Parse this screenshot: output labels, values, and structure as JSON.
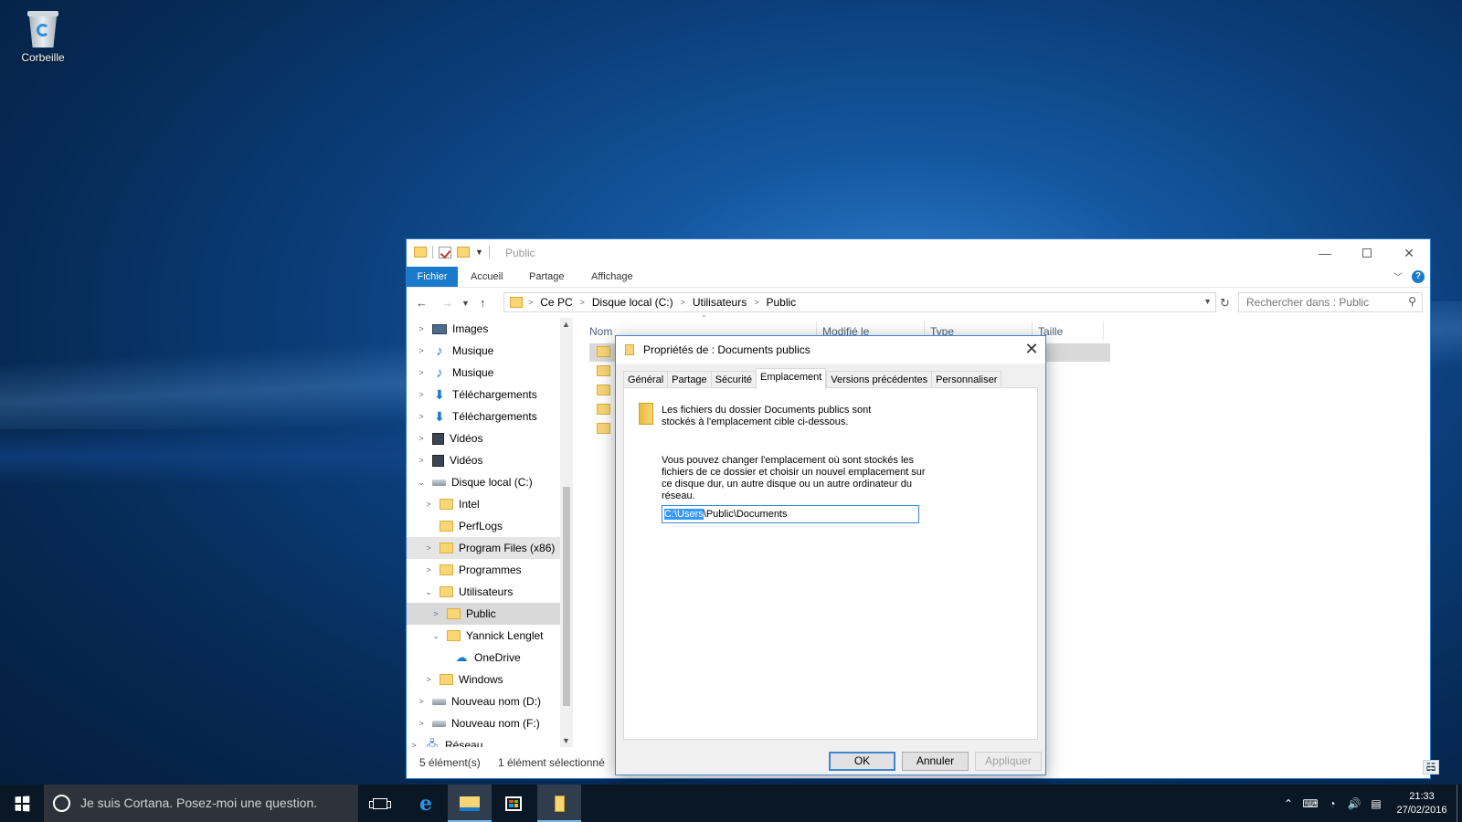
{
  "desktop": {
    "recycle_bin_label": "Corbeille"
  },
  "explorer": {
    "title": "Public",
    "ribbon_tabs": {
      "file": "Fichier",
      "home": "Accueil",
      "share": "Partage",
      "view": "Affichage"
    },
    "breadcrumb": [
      "Ce PC",
      "Disque local (C:)",
      "Utilisateurs",
      "Public"
    ],
    "search_placeholder": "Rechercher dans : Public",
    "tree": {
      "images": "Images",
      "music1": "Musique",
      "music2": "Musique",
      "downloads1": "Téléchargements",
      "downloads2": "Téléchargements",
      "videos1": "Vidéos",
      "videos2": "Vidéos",
      "local_disk": "Disque local (C:)",
      "intel": "Intel",
      "perflogs": "PerfLogs",
      "program_files_x86": "Program Files (x86)",
      "programmes": "Programmes",
      "utilisateurs": "Utilisateurs",
      "public": "Public",
      "yannick": "Yannick Lenglet",
      "onedrive": "OneDrive",
      "windows": "Windows",
      "drive_d": "Nouveau nom (D:)",
      "drive_f": "Nouveau nom (F:)",
      "network": "Réseau"
    },
    "columns": {
      "name": "Nom",
      "modified": "Modifié le",
      "type": "Type",
      "size": "Taille"
    },
    "status": {
      "count": "5 élément(s)",
      "selected": "1 élément sélectionné"
    }
  },
  "dialog": {
    "title": "Propriétés de : Documents publics",
    "tabs": {
      "general": "Général",
      "share": "Partage",
      "security": "Sécurité",
      "location": "Emplacement",
      "versions": "Versions précédentes",
      "customize": "Personnaliser"
    },
    "text1": "Les fichiers du dossier Documents publics sont stockés à l'emplacement cible ci-dessous.",
    "text2": "Vous pouvez changer l'emplacement où sont stockés les fichiers de ce dossier et choisir un nouvel emplacement sur ce disque dur, un autre disque ou un autre ordinateur du réseau.",
    "path_selected": "C:\\Users",
    "path_rest": "\\Public\\Documents",
    "buttons": {
      "ok": "OK",
      "cancel": "Annuler",
      "apply": "Appliquer"
    }
  },
  "taskbar": {
    "cortana_placeholder": "Je suis Cortana. Posez-moi une question.",
    "time": "21:33",
    "date": "27/02/2016"
  }
}
